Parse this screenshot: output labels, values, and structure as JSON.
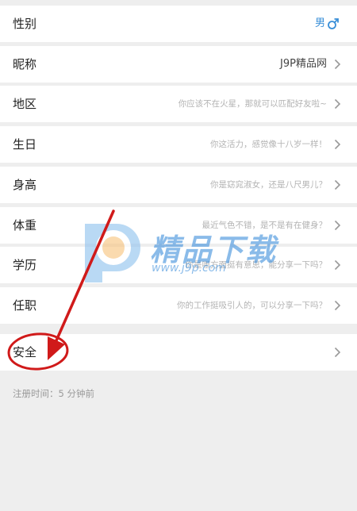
{
  "profile": {
    "rows": [
      {
        "label": "性别",
        "value": "男"
      },
      {
        "label": "昵称",
        "value": "J9P精品网"
      },
      {
        "label": "地区",
        "value": "你应该不在火星，那就可以匹配好友啦~"
      },
      {
        "label": "生日",
        "value": "你这活力，感觉像十八岁一样！"
      },
      {
        "label": "身高",
        "value": "你是窈窕淑女，还是八尺男儿？"
      },
      {
        "label": "体重",
        "value": "最近气色不错，是不是有在健身？"
      },
      {
        "label": "学历",
        "value": "你是哪方面挺有意思，能分享一下吗？"
      },
      {
        "label": "任职",
        "value": "你的工作挺吸引人的，可以分享一下吗？"
      }
    ],
    "security": {
      "label": "安全"
    },
    "register_time": "注册时间：5 分钟前"
  },
  "watermark": {
    "text": "精品下载",
    "url": "www.j9p.com"
  },
  "colors": {
    "gender_accent": "#3a8fd8",
    "annotation": "#d01a1a",
    "background": "#eeeeee"
  },
  "icons": {
    "gender": "male-symbol-icon",
    "row_action": "chevron-right-icon"
  }
}
